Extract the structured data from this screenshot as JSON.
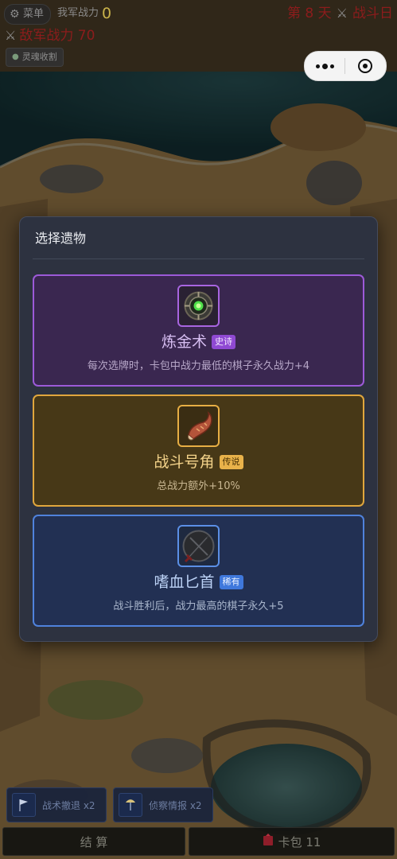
{
  "hud": {
    "menu_label": "菜单",
    "our_power_label": "我军战力",
    "our_power_value": "0",
    "day_label": "第 8 天",
    "phase_label": "战斗日",
    "enemy_power_label": "敌军战力 70",
    "soul_label": "灵魂收割"
  },
  "modal": {
    "title": "选择遗物",
    "relics": [
      {
        "name": "炼金术",
        "rarity": "史诗",
        "desc": "每次选牌时，卡包中战力最低的棋子永久战力+4",
        "icon": "alchemy-orb-icon",
        "color": "#9c5ad8"
      },
      {
        "name": "战斗号角",
        "rarity": "传说",
        "desc": "总战力额外+10%",
        "icon": "war-horn-icon",
        "color": "#e0a63d"
      },
      {
        "name": "嗜血匕首",
        "rarity": "稀有",
        "desc": "战斗胜利后，战力最高的棋子永久+5",
        "icon": "bloodthirst-dagger-icon",
        "color": "#4f82dc"
      }
    ]
  },
  "bottom": {
    "skills": [
      {
        "label": "战术撤退 x2",
        "icon": "flag-icon"
      },
      {
        "label": "侦察情报 x2",
        "icon": "scout-icon"
      }
    ],
    "settle_label": "结 算",
    "card_pack_label": "卡包 11"
  }
}
